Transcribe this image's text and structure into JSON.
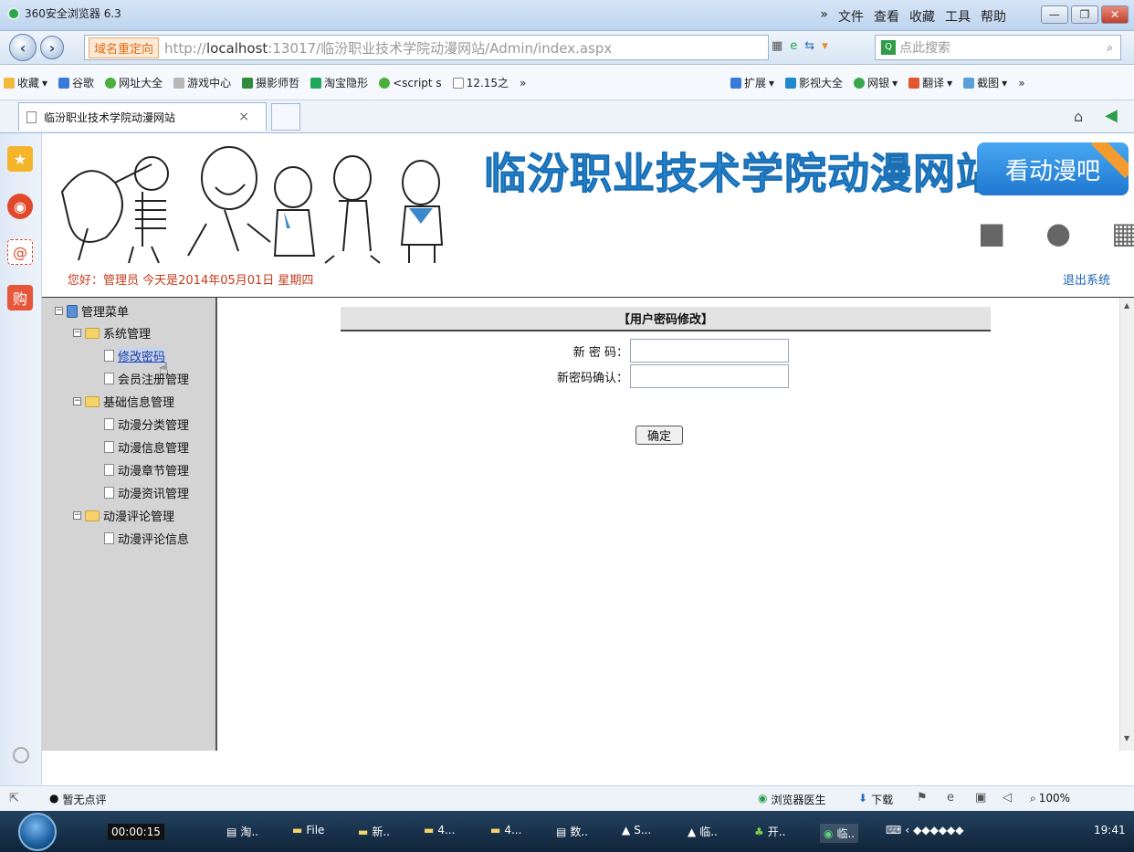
{
  "window": {
    "app_title": "360安全浏览器 6.3",
    "menu": [
      "»",
      "文件",
      "查看",
      "收藏",
      "工具",
      "帮助"
    ],
    "min": "—",
    "max": "❐",
    "close": "✕"
  },
  "nav": {
    "redirect_badge": "域名重定向",
    "url_prefix": "http://",
    "url_host": "localhost",
    "url_rest": ":13017/临汾职业技术学院动漫网站/Admin/index.aspx",
    "search_placeholder": "点此搜索"
  },
  "bookmarks": [
    "收藏",
    "谷歌",
    "网址大全",
    "游戏中心",
    "摄影师哲",
    "淘宝隐形",
    "<script s",
    "12.15之",
    "»"
  ],
  "bookmarks_right": [
    "扩展",
    "影视大全",
    "网银",
    "翻译",
    "截图",
    "»"
  ],
  "tab": {
    "title": "临汾职业技术学院动漫网站",
    "close": "×"
  },
  "header": {
    "site_title": "临汾职业技术学院动漫网站",
    "watch_button": "看动漫吧",
    "greeting": "您好：管理员   今天是2014年05月01日   星期四",
    "logout": "退出系统"
  },
  "tree": {
    "root": "管理菜单",
    "groups": [
      {
        "label": "系统管理",
        "items": [
          "修改密码",
          "会员注册管理"
        ]
      },
      {
        "label": "基础信息管理",
        "items": [
          "动漫分类管理",
          "动漫信息管理",
          "动漫章节管理",
          "动漫资讯管理"
        ]
      },
      {
        "label": "动漫评论管理",
        "items": [
          "动漫评论信息"
        ]
      }
    ]
  },
  "form": {
    "title": "【用户密码修改】",
    "new_password_label": "新 密 码：",
    "confirm_label": "新密码确认：",
    "submit": "确定"
  },
  "status": {
    "left": "暂无点评",
    "doctor": "浏览器医生",
    "download": "下载",
    "zoom": "100%"
  },
  "taskbar": {
    "timer": "00:00:15",
    "items": [
      "淘..",
      "File",
      "新..",
      "4...",
      "4...",
      "数..",
      "S...",
      "临..",
      "开..",
      "临.."
    ],
    "clock": "19:41"
  }
}
